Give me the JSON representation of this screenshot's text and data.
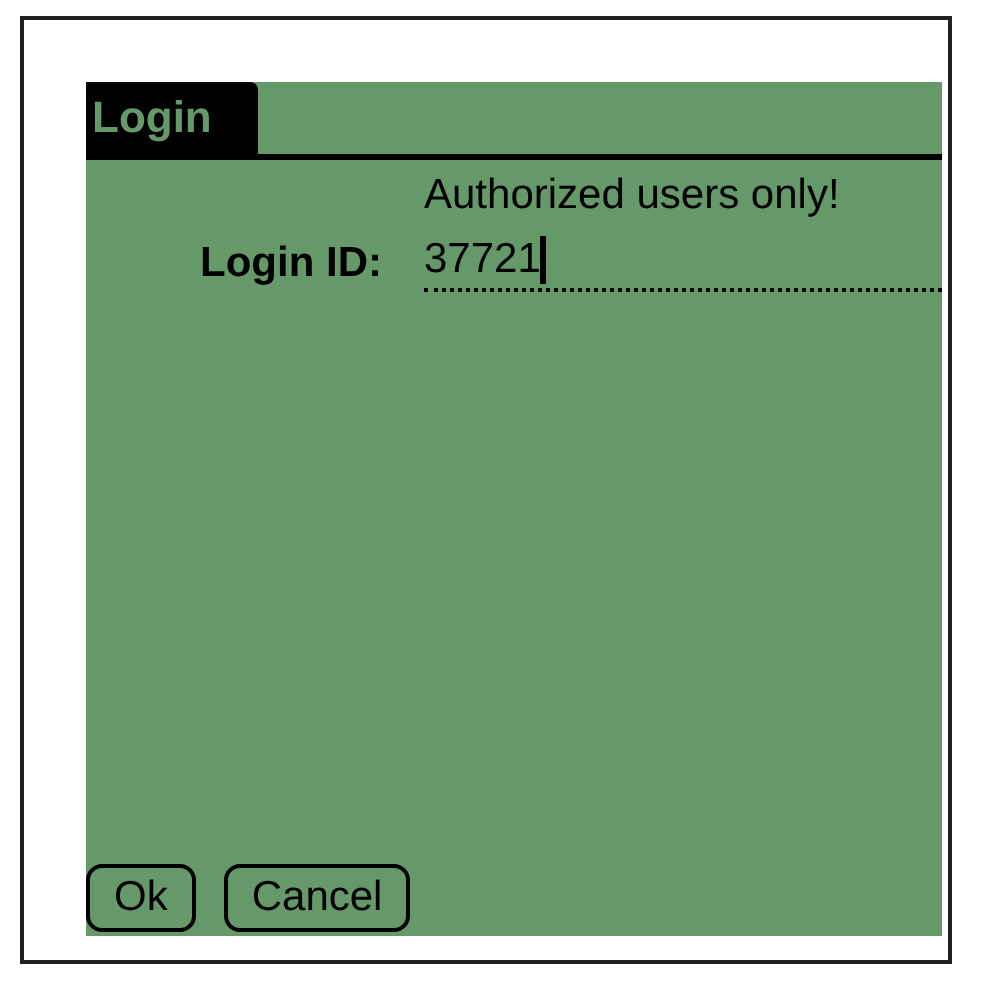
{
  "form": {
    "title": "Login",
    "notice": "Authorized users only!",
    "login_field": {
      "label": "Login ID:",
      "value": "37721",
      "focused": true
    },
    "buttons": [
      {
        "label": "Ok"
      },
      {
        "label": "Cancel"
      }
    ]
  }
}
